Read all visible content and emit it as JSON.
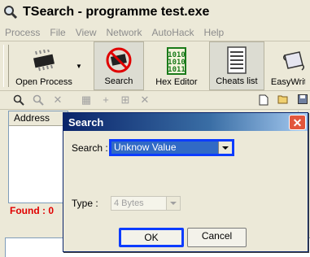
{
  "window": {
    "title": "TSearch - programme test.exe",
    "icon": "magnifier-icon"
  },
  "menu": {
    "items": [
      "Process",
      "File",
      "View",
      "Network",
      "AutoHack",
      "Help"
    ]
  },
  "toolbar": {
    "buttons": [
      {
        "label": "Open Process",
        "icon": "chip-icon"
      },
      {
        "label": "Search",
        "icon": "no-chip-icon"
      },
      {
        "label": "Hex Editor",
        "icon": "binary-icon"
      },
      {
        "label": "Cheats list",
        "icon": "list-icon"
      },
      {
        "label": "EasyWrit",
        "icon": "scroll-icon"
      }
    ]
  },
  "list": {
    "header": "Address"
  },
  "status": {
    "found": "Found : 0"
  },
  "dialog": {
    "title": "Search",
    "search_label": "Search :",
    "search_value": "Unknow Value",
    "type_label": "Type :",
    "type_value": "4 Bytes",
    "ok_label": "OK",
    "cancel_label": "Cancel"
  },
  "colors": {
    "highlight_border": "#0c3cff",
    "found_text": "#e00000",
    "selection": "#316ac5"
  }
}
